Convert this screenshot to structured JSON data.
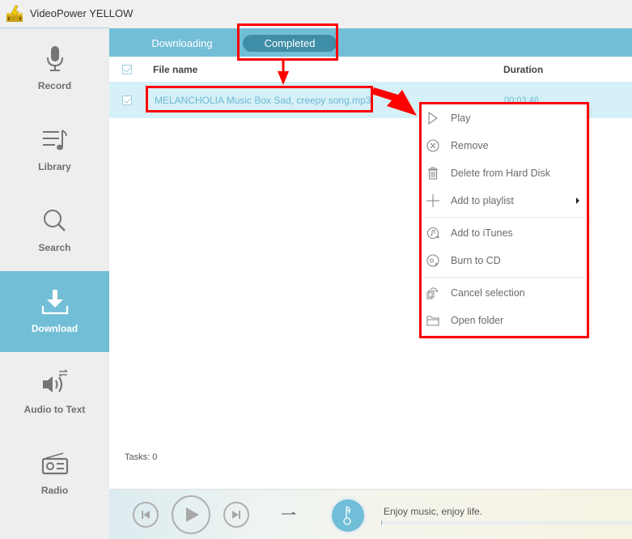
{
  "app": {
    "title": "VideoPower YELLOW",
    "accent_color": "#72bed6",
    "annotation_color": "#ff0000"
  },
  "sidebar": {
    "items": [
      {
        "label": "Record",
        "icon": "microphone-icon",
        "active": false
      },
      {
        "label": "Library",
        "icon": "music-list-icon",
        "active": false
      },
      {
        "label": "Search",
        "icon": "search-icon",
        "active": false
      },
      {
        "label": "Download",
        "icon": "download-icon",
        "active": true
      },
      {
        "label": "Audio to Text",
        "icon": "speaker-convert-icon",
        "active": false
      },
      {
        "label": "Radio",
        "icon": "radio-icon",
        "active": false
      }
    ]
  },
  "tabs": [
    {
      "label": "Downloading",
      "active": false
    },
    {
      "label": "Completed",
      "active": true
    }
  ],
  "table": {
    "columns": [
      "File name",
      "Duration"
    ],
    "rows": [
      {
        "file_name": "MELANCHOLIA Music Box Sad, creepy song.mp3",
        "duration": "00:03:46",
        "checked": true,
        "selected": true
      }
    ]
  },
  "status": {
    "tasks_label": "Tasks: 0"
  },
  "player": {
    "now_playing": "Enjoy music, enjoy life.",
    "progress_fraction": 0
  },
  "context_menu": {
    "items": [
      {
        "label": "Play",
        "icon": "play-icon"
      },
      {
        "label": "Remove",
        "icon": "remove-circle-icon"
      },
      {
        "label": "Delete from Hard Disk",
        "icon": "trash-icon"
      },
      {
        "label": "Add to playlist",
        "icon": "plus-icon",
        "submenu": true
      },
      {
        "label": "Add to iTunes",
        "icon": "itunes-add-icon"
      },
      {
        "label": "Burn to CD",
        "icon": "burn-cd-icon"
      },
      {
        "label": "Cancel selection",
        "icon": "cancel-selection-icon"
      },
      {
        "label": "Open folder",
        "icon": "folder-icon"
      }
    ]
  }
}
